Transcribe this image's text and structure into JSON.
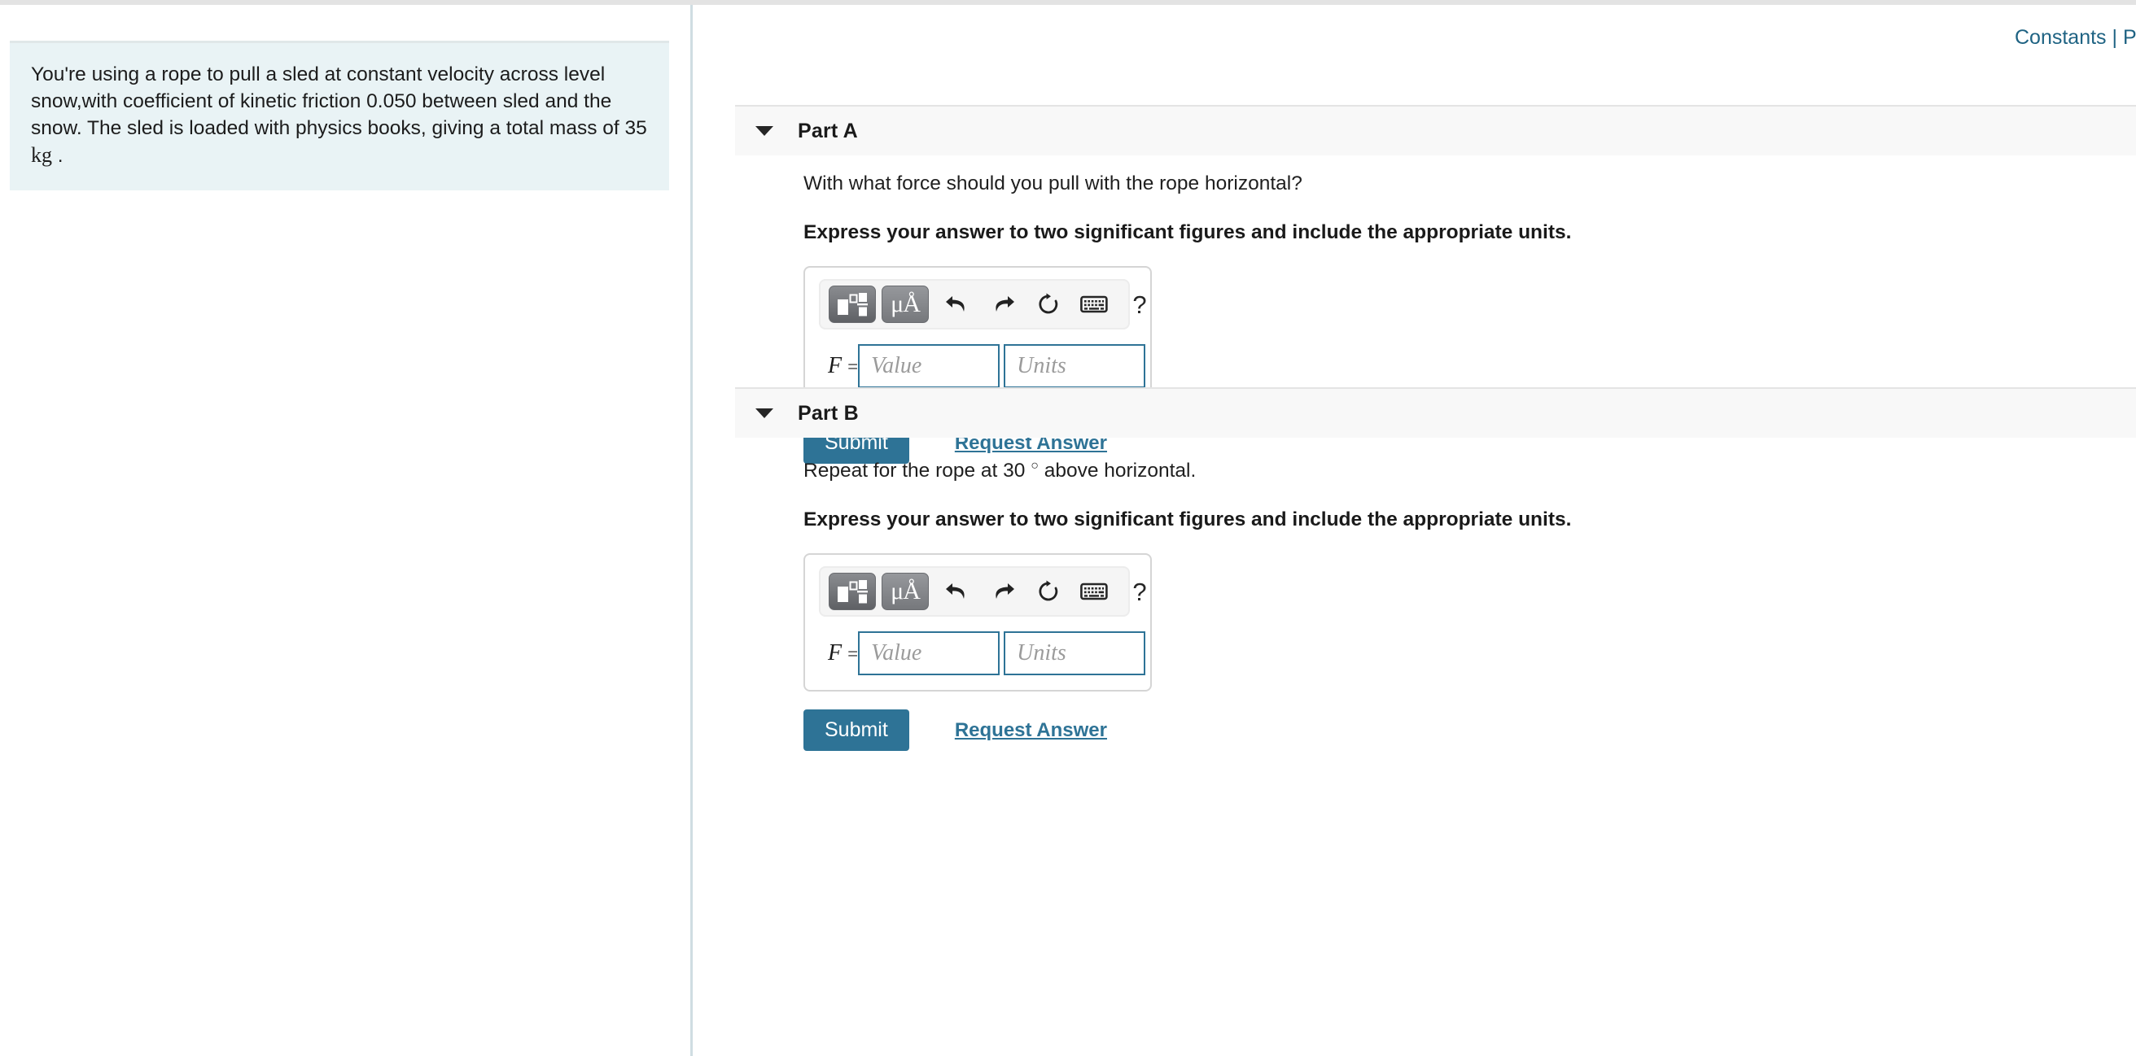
{
  "problem": {
    "text_line1": "You're using a rope to pull a sled at constant velocity across level",
    "text_line2": "snow,with coefficient of kinetic friction 0.050 between sled and the",
    "text_line3": "snow. The sled is loaded with physics books, giving a total mass",
    "text_line4_prefix": "of 35 ",
    "text_line4_unit": "kg",
    "text_line4_suffix": " ."
  },
  "header": {
    "constants_link": "Constants | P"
  },
  "colors": {
    "accent_teal": "#2e7396",
    "problem_panel_bg": "#e9f3f5",
    "part_header_bg": "#f8f8f8",
    "divider": "#cfdde2"
  },
  "toolbar": {
    "template_button_name": "math-template",
    "units_button_label": "μÅ",
    "undo_label": "undo",
    "redo_label": "redo",
    "reset_label": "reset",
    "keyboard_label": "keyboard",
    "help_label": "?"
  },
  "input": {
    "variable": "F",
    "equals": "=",
    "value_placeholder": "Value",
    "units_placeholder": "Units",
    "value": "",
    "units": ""
  },
  "actions": {
    "submit_label": "Submit",
    "request_answer_label": "Request Answer"
  },
  "parts": [
    {
      "title": "Part A",
      "question_prefix": "With what force should you pull with the rope horizontal?",
      "question_sup": "",
      "question_suffix": "",
      "express_note": "Express your answer to two significant figures and include the appropriate units."
    },
    {
      "title": "Part B",
      "question_prefix": "Repeat for the rope at 30 ",
      "question_sup": "○",
      "question_suffix": " above horizontal.",
      "express_note": "Express your answer to two significant figures and include the appropriate units."
    }
  ]
}
